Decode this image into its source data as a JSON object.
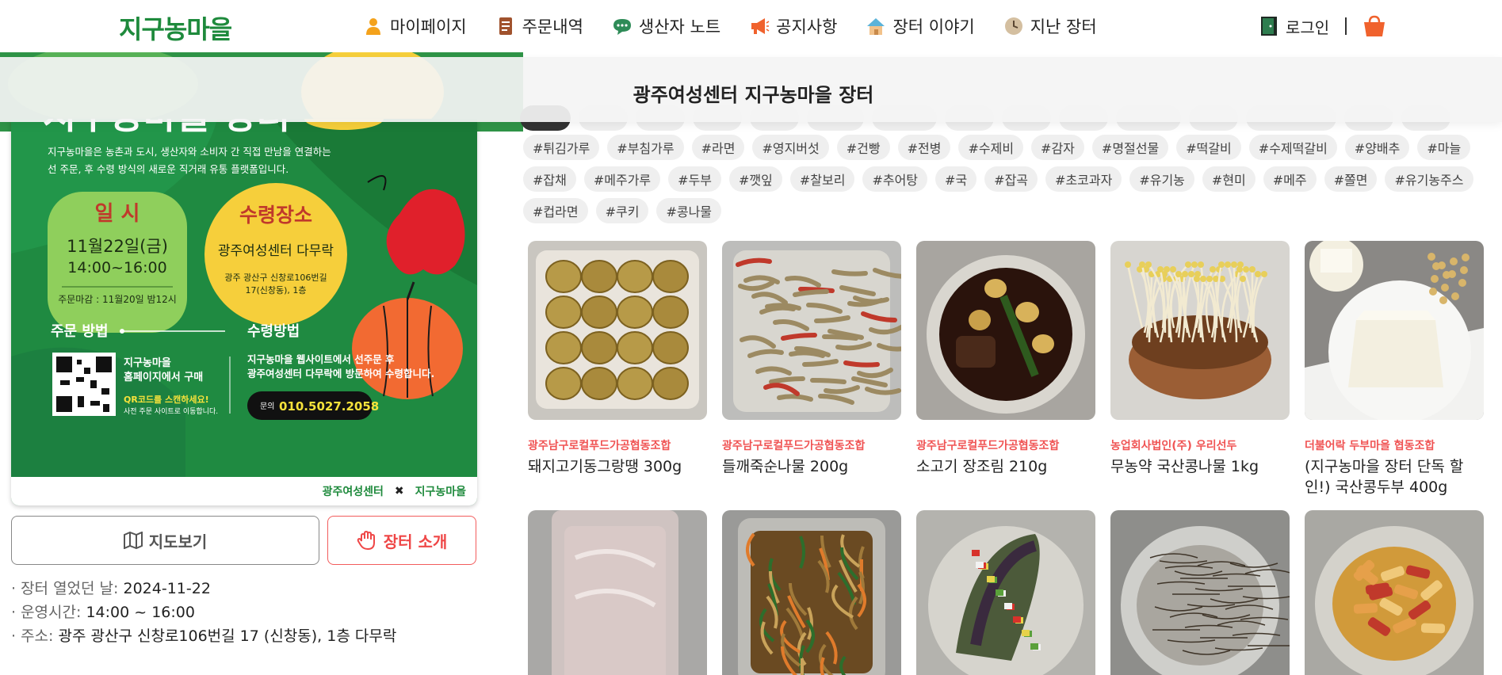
{
  "brand": {
    "logo_text": "지구농마을",
    "accent": "#1e8a3c",
    "red": "#ef4747"
  },
  "nav": {
    "items": [
      {
        "label": "마이페이지",
        "icon": "person-icon"
      },
      {
        "label": "주문내역",
        "icon": "receipt-icon"
      },
      {
        "label": "생산자 노트",
        "icon": "chat-bubble-icon"
      },
      {
        "label": "공지사항",
        "icon": "megaphone-icon"
      },
      {
        "label": "장터 이야기",
        "icon": "house-icon"
      },
      {
        "label": "지난 장터",
        "icon": "clock-icon"
      }
    ],
    "login_label": "로그인"
  },
  "page": {
    "title": "광주여성센터 지구농마을 장터"
  },
  "poster": {
    "intro": "지구농마을은 농촌과 도시, 생산자와 소비자 간 직접 만남을 연결하는\n선 주문, 후 수령 방식의 새로운 직거래 유통 플랫폼입니다.",
    "date_title": "일 시",
    "date": "11월22일(금)",
    "time": "14:00~16:00",
    "deadline": "주문마감 : 11월20일 밤12시",
    "place_title": "수령장소",
    "place": "광주여성센터 다무락",
    "address_1": "광주 광산구 신창로106번길",
    "address_2": "17(신창동), 1층",
    "order_title": "주문 방법",
    "order_desc_1": "지구농마을",
    "order_desc_2": "홈페이지에서 구매",
    "qr_hint": "QR코드를 스캔하세요!",
    "qr_sub": "사전 주문 사이트로 이동합니다.",
    "receive_title": "수령방법",
    "receive_desc_1": "지구농마을 웹사이트에서 선주문 후",
    "receive_desc_2": "광주여성센터 다무락에 방문하여 수령합니다.",
    "contact_label": "문의",
    "contact_phone": "010.5027.2058",
    "footer_left": "광주여성센터",
    "footer_x": "✖",
    "footer_right": "지구농마을"
  },
  "buttons": {
    "map": "지도보기",
    "intro": "장터 소개"
  },
  "info": {
    "opened_label": "· 장터 열었던 날:",
    "opened_value": "2024-11-22",
    "hours_label": "· 운영시간:",
    "hours_value": "14:00 ~ 16:00",
    "address_label": "· 주소:",
    "address_value": "광주 광산구 신창로106번길 17 (신창동), 1층 다무락"
  },
  "tags": {
    "row2": [
      "#튀김가루",
      "#부침가루",
      "#라면",
      "#영지버섯",
      "#건빵",
      "#전병",
      "#수제비",
      "#감자",
      "#명절선물",
      "#떡갈비",
      "#수제떡갈비",
      "#양배추",
      "#마늘"
    ],
    "row3": [
      "#잡채",
      "#메주가루",
      "#두부",
      "#깻잎",
      "#찰보리",
      "#추어탕",
      "#국",
      "#잡곡",
      "#초코과자",
      "#유기농",
      "#현미",
      "#메주",
      "#쫄면",
      "#유기농주스"
    ],
    "row4": [
      "#컵라면",
      "#쿠키",
      "#콩나물"
    ]
  },
  "products": [
    {
      "seller": "광주남구로컬푸드가공협동조합",
      "name": "돼지고기동그랑땡 300g",
      "photo": "pancakes"
    },
    {
      "seller": "광주남구로컬푸드가공협동조합",
      "name": "들깨죽순나물 200g",
      "photo": "bamboo"
    },
    {
      "seller": "광주남구로컬푸드가공협동조합",
      "name": "소고기 장조림 210g",
      "photo": "braised-beef"
    },
    {
      "seller": "농업회사법인(주) 우리선두",
      "name": "무농약 국산콩나물 1kg",
      "photo": "sprouts"
    },
    {
      "seller": "더불어락 두부마을 협동조합",
      "name": "(지구농마을 장터 단독 할인!) 국산콩두부 400g",
      "photo": "tofu"
    },
    {
      "seller": "",
      "name": "",
      "photo": "meat-pack"
    },
    {
      "seller": "",
      "name": "",
      "photo": "japchae"
    },
    {
      "seller": "",
      "name": "",
      "photo": "eggplant"
    },
    {
      "seller": "",
      "name": "",
      "photo": "glass-noodles"
    },
    {
      "seller": "",
      "name": "",
      "photo": "tteokbokki"
    }
  ]
}
